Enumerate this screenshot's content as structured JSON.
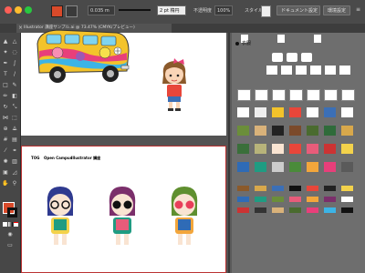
{
  "window": {
    "traffic_colors": [
      "#ff5f57",
      "#febc2e",
      "#28c840"
    ]
  },
  "controlbar": {
    "stroke_weight": "0.035 m",
    "brush": "2 pt 楕円",
    "opacity_label": "不透明度",
    "opacity_value": "100%",
    "style_label": "スタイル",
    "doc_settings": "ドキュメント設定",
    "prefs": "環境設定"
  },
  "tabs": {
    "active": "Illustrator 講座サンプル.ai @ 73.47% (CMYK/プレビュー)"
  },
  "artboard2": {
    "labels": [
      "TOG",
      "Open Campus",
      "Illustrator 講座"
    ]
  },
  "rightdoc": {
    "section_title": "衣服"
  },
  "colors": {
    "fill": "#d94a2a",
    "accent": "#cc3333"
  },
  "icons": [
    "selection-tool-icon",
    "direct-selection-icon",
    "pen-tool-icon",
    "type-tool-icon",
    "line-tool-icon",
    "rectangle-tool-icon",
    "paintbrush-icon",
    "pencil-icon",
    "eraser-icon",
    "rotate-icon",
    "scale-icon",
    "width-icon",
    "shape-builder-icon",
    "eyedropper-icon",
    "blend-icon",
    "symbol-sprayer-icon",
    "graph-icon",
    "artboard-icon",
    "slice-icon",
    "hand-icon",
    "zoom-icon"
  ]
}
